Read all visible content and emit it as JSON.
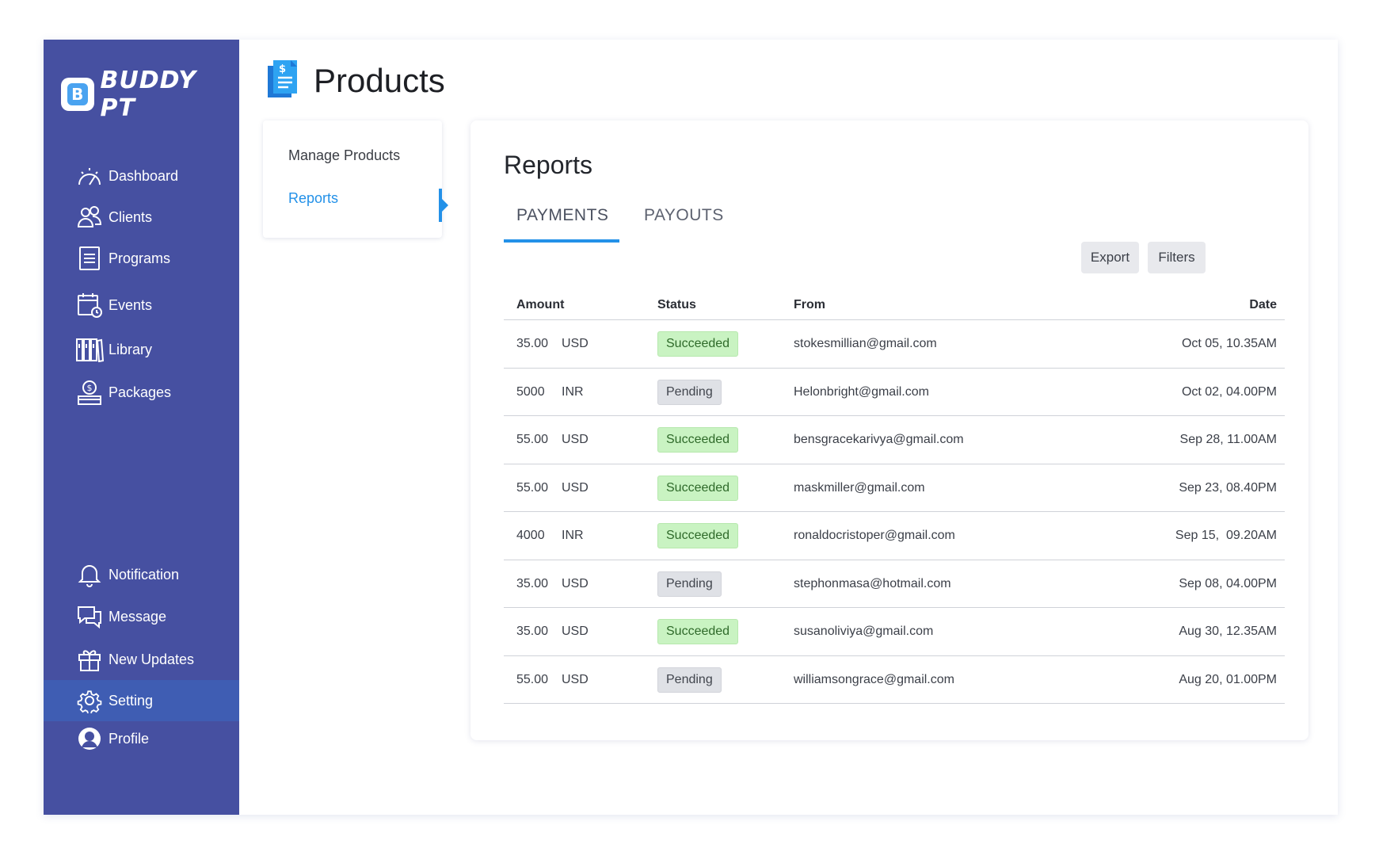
{
  "brand": {
    "name": "BUDDY PT",
    "badge_letter": "B"
  },
  "sidebar": {
    "top_items": [
      {
        "label": "Dashboard",
        "icon": "speedometer-icon"
      },
      {
        "label": "Clients",
        "icon": "users-icon"
      },
      {
        "label": "Programs",
        "icon": "list-document-icon"
      },
      {
        "label": "Events",
        "icon": "calendar-clock-icon"
      },
      {
        "label": "Library",
        "icon": "books-icon"
      },
      {
        "label": "Packages",
        "icon": "money-bag-icon"
      }
    ],
    "bottom_items": [
      {
        "label": "Notification",
        "icon": "bell-icon"
      },
      {
        "label": "Message",
        "icon": "chat-icon"
      },
      {
        "label": "New Updates",
        "icon": "gift-icon"
      },
      {
        "label": "Setting",
        "icon": "gear-icon",
        "active": true
      },
      {
        "label": "Profile",
        "icon": "user-circle-icon"
      }
    ]
  },
  "page": {
    "title": "Products",
    "icon": "invoice-document-icon"
  },
  "submenu": {
    "items": [
      "Manage Products",
      "Reports"
    ],
    "active": "Reports"
  },
  "reports": {
    "title": "Reports",
    "tabs": [
      "PAYMENTS",
      "PAYOUTS"
    ],
    "active_tab": "PAYMENTS",
    "buttons": {
      "export": "Export",
      "filters": "Filters"
    },
    "columns": [
      "Amount",
      "Status",
      "From",
      "Date"
    ],
    "rows": [
      {
        "amount": "35.00",
        "currency": "USD",
        "status": "Succeeded",
        "from": "stokesmillian@gmail.com",
        "date": "Oct 05, 10.35AM"
      },
      {
        "amount": "5000",
        "currency": "INR",
        "status": "Pending",
        "from": "Helonbright@gmail.com",
        "date": "Oct 02, 04.00PM"
      },
      {
        "amount": "55.00",
        "currency": "USD",
        "status": "Succeeded",
        "from": "bensgracekarivya@gmail.com",
        "date": "Sep 28, 11.00AM"
      },
      {
        "amount": "55.00",
        "currency": "USD",
        "status": "Succeeded",
        "from": "maskmiller@gmail.com",
        "date": "Sep 23, 08.40PM"
      },
      {
        "amount": "4000",
        "currency": "INR",
        "status": "Succeeded",
        "from": "ronaldocristoper@gmail.com",
        "date": "Sep 15,  09.20AM"
      },
      {
        "amount": "35.00",
        "currency": "USD",
        "status": "Pending",
        "from": "stephonmasa@hotmail.com",
        "date": "Sep 08, 04.00PM"
      },
      {
        "amount": "35.00",
        "currency": "USD",
        "status": "Succeeded",
        "from": "susanoliviya@gmail.com",
        "date": "Aug 30, 12.35AM"
      },
      {
        "amount": "55.00",
        "currency": "USD",
        "status": "Pending",
        "from": "williamsongrace@gmail.com",
        "date": "Aug 20, 01.00PM"
      }
    ]
  },
  "colors": {
    "sidebar": "#4650a1",
    "sidebar_active": "#3f5db3",
    "accent": "#2391e8",
    "success_bg": "#c9f3c2",
    "pending_bg": "#dfe1e6"
  }
}
